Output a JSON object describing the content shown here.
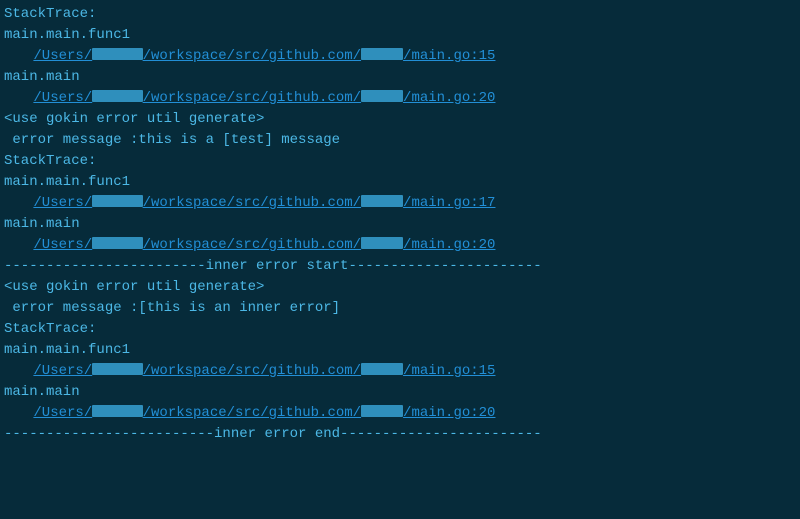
{
  "blocks": [
    {
      "stacktrace_label": "StackTrace:",
      "frames": [
        {
          "func": "main.main.func1",
          "p1": "/Users/",
          "p2": "/workspace/src/github.com/",
          "p3": "/main.go:15"
        },
        {
          "func": "main.main",
          "p1": "/Users/",
          "p2": "/workspace/src/github.com/",
          "p3": "/main.go:20"
        }
      ]
    },
    {
      "header": "<use gokin error util generate>",
      "message": " error message :this is a [test] message",
      "stacktrace_label": "StackTrace:",
      "frames": [
        {
          "func": "main.main.func1",
          "p1": "/Users/",
          "p2": "/workspace/src/github.com/",
          "p3": "/main.go:17"
        },
        {
          "func": "main.main",
          "p1": "/Users/",
          "p2": "/workspace/src/github.com/",
          "p3": "/main.go:20"
        }
      ]
    }
  ],
  "inner": {
    "start_rule": "------------------------inner error start-----------------------",
    "header": "<use gokin error util generate>",
    "message": " error message :[this is an inner error]",
    "stacktrace_label": "StackTrace:",
    "frames": [
      {
        "func": "main.main.func1",
        "p1": "/Users/",
        "p2": "/workspace/src/github.com/",
        "p3": "/main.go:15"
      },
      {
        "func": "main.main",
        "p1": "/Users/",
        "p2": "/workspace/src/github.com/",
        "p3": "/main.go:20"
      }
    ],
    "end_rule": "-------------------------inner error end------------------------"
  },
  "blank": ""
}
